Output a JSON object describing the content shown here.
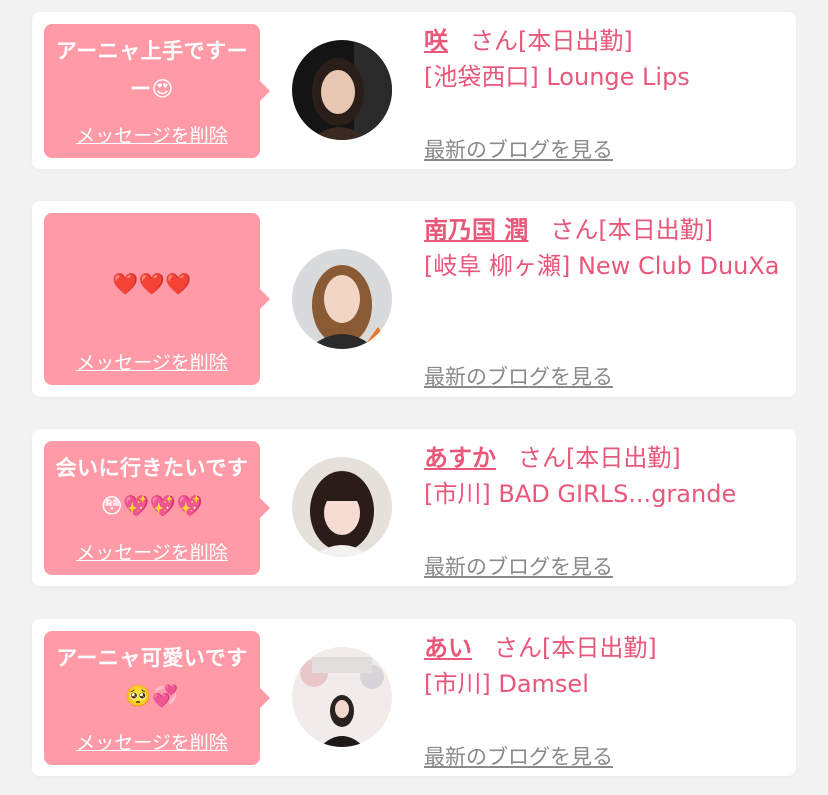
{
  "cards": [
    {
      "message": "アーニャ上手ですーー😍",
      "delete_label": "メッセージを削除",
      "avatar_desc": "woman dark hair",
      "name": "咲",
      "name_suffix": "さん[本日出勤]",
      "shop": "[池袋西口] Lounge Lips",
      "blog_label": "最新のブログを見る"
    },
    {
      "message": "❤️❤️❤️",
      "delete_label": "メッセージを削除",
      "avatar_desc": "woman light brown hair",
      "name": "南乃国 潤",
      "name_suffix": "さん[本日出勤]",
      "shop": "[岐阜 柳ヶ瀬] New Club DuuXa",
      "blog_label": "最新のブログを見る"
    },
    {
      "message": "会いに行きたいです😳💖💖💖",
      "delete_label": "メッセージを削除",
      "avatar_desc": "woman bangs",
      "name": "あすか",
      "name_suffix": "さん[本日出勤]",
      "shop": "[市川] BAD GIRLS...grande",
      "blog_label": "最新のブログを見る"
    },
    {
      "message": "アーニャ可愛いです🥺💞",
      "delete_label": "メッセージを削除",
      "avatar_desc": "woman with balloons",
      "name": "あい",
      "name_suffix": "さん[本日出勤]",
      "shop": "[市川] Damsel",
      "blog_label": "最新のブログを見る"
    }
  ],
  "colors": {
    "bubble": "#ff9aa6",
    "accent": "#e9577a",
    "link_gray": "#8a8a8a",
    "background": "#f2f2f2"
  }
}
